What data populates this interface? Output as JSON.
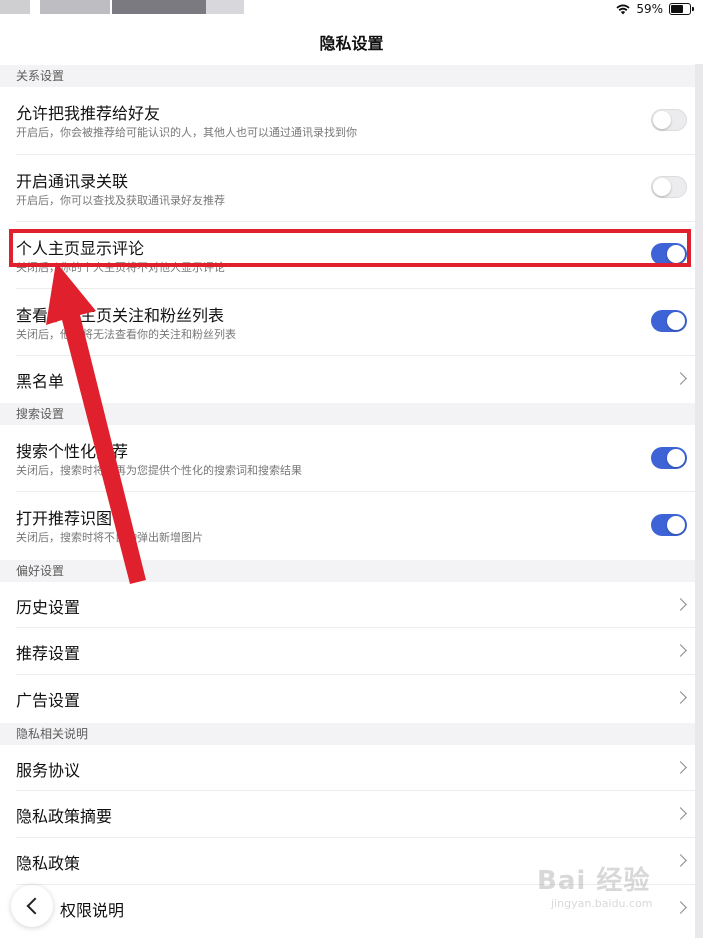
{
  "status_bar": {
    "battery": "59%",
    "battery_level": 0.59
  },
  "header": {
    "title": "隐私设置"
  },
  "sections": {
    "relation": {
      "header": "关系设置",
      "recommend": {
        "title": "允许把我推荐给好友",
        "subtitle": "开启后，你会被推荐给可能认识的人，其他人也可以通过通讯录找到你",
        "toggle": "off"
      },
      "contacts": {
        "title": "开启通讯录关联",
        "subtitle": "开启后，你可以查找及获取通讯录好友推荐",
        "toggle": "off"
      },
      "show_comments": {
        "title": "个人主页显示评论",
        "subtitle": "关闭后，你的个人主页将不对他人显示评论",
        "toggle": "on"
      },
      "follow_list": {
        "title": "查看个人主页关注和粉丝列表",
        "subtitle": "关闭后，他人将无法查看你的关注和粉丝列表",
        "toggle": "on"
      },
      "blacklist": {
        "title": "黑名单"
      }
    },
    "search": {
      "header": "搜索设置",
      "personalized": {
        "title": "搜索个性化推荐",
        "subtitle": "关闭后，搜索时将不再为您提供个性化的搜索词和搜索结果",
        "toggle": "on"
      },
      "image_recognition": {
        "title": "打开推荐识图",
        "subtitle": "关闭后，搜索时将不自动弹出新增图片",
        "toggle": "on"
      }
    },
    "preference": {
      "header": "偏好设置",
      "history": {
        "title": "历史设置"
      },
      "recommend_settings": {
        "title": "推荐设置"
      },
      "ad_settings": {
        "title": "广告设置"
      }
    },
    "privacy_info": {
      "header": "隐私相关说明",
      "service": {
        "title": "服务协议"
      },
      "policy_summary": {
        "title": "隐私政策摘要"
      },
      "policy": {
        "title": "隐私政策"
      },
      "permissions": {
        "title": "权限说明"
      }
    }
  },
  "watermark": {
    "main": "Bai 经验",
    "sub": "jingyan.baidu.com"
  },
  "colors": {
    "toggle_on": "#3d63d6",
    "highlight": "#e0202c",
    "section_bg": "#f3f3f5"
  }
}
